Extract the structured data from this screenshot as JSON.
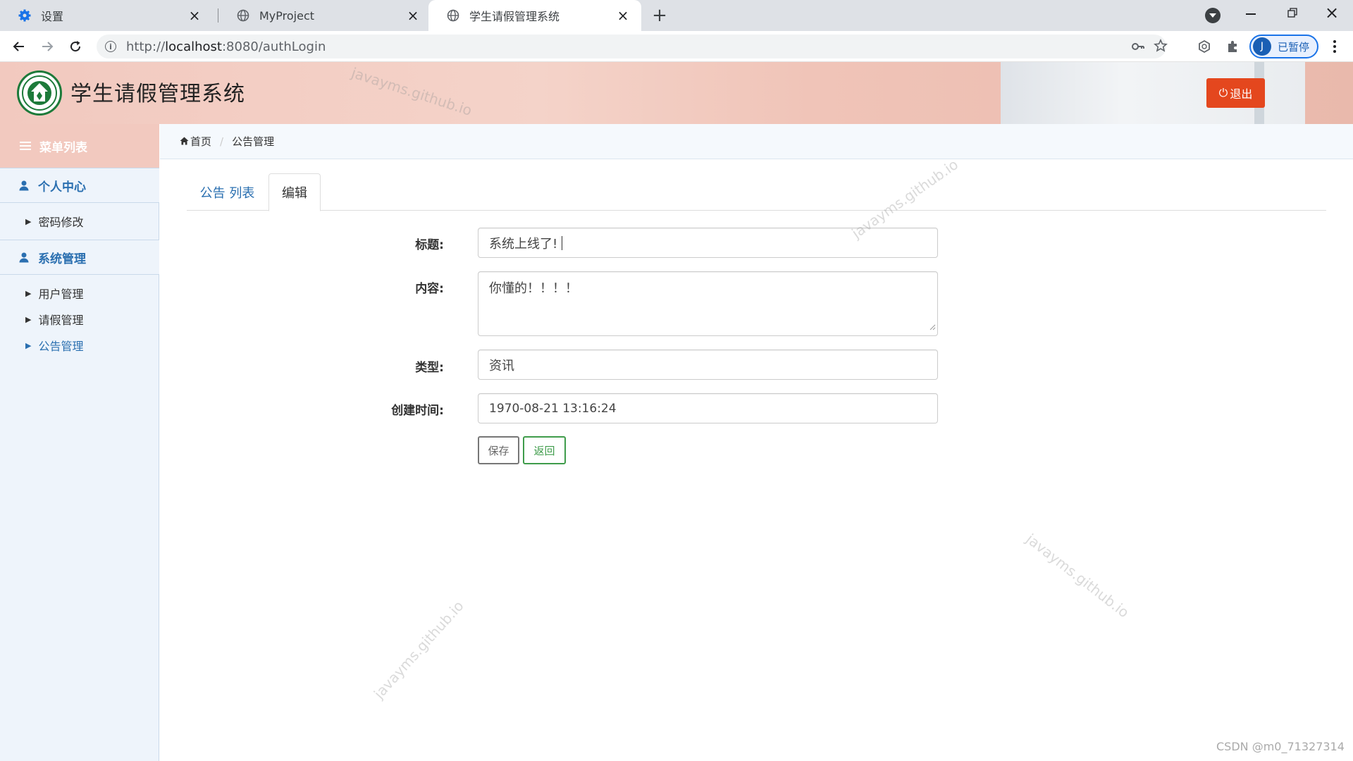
{
  "browser": {
    "tabs": [
      {
        "label": "设置",
        "icon": "gear-icon"
      },
      {
        "label": "MyProject",
        "icon": "globe-icon"
      },
      {
        "label": "学生请假管理系统",
        "icon": "globe-icon"
      }
    ],
    "active_tab": 2,
    "url_prefix": "http://",
    "url_host": "localhost",
    "url_path": ":8080/authLogin",
    "profile_initial": "J",
    "profile_label": "已暂停"
  },
  "app": {
    "title": "学生请假管理系统",
    "logout_label": "退出",
    "watermark": "javayms.github.io"
  },
  "sidebar": {
    "header": "菜单列表",
    "groups": [
      {
        "label": "个人中心",
        "items": [
          "密码修改"
        ]
      },
      {
        "label": "系统管理",
        "items": [
          "用户管理",
          "请假管理",
          "公告管理"
        ]
      }
    ],
    "active_item": "公告管理"
  },
  "breadcrumb": {
    "home": "首页",
    "current": "公告管理"
  },
  "content_tabs": {
    "list": "公告 列表",
    "edit": "编辑"
  },
  "form": {
    "title_label": "标题:",
    "title_value": "系统上线了!",
    "content_label": "内容:",
    "content_value": "你懂的！！！！",
    "type_label": "类型:",
    "type_value": "资讯",
    "created_label": "创建时间:",
    "created_value": "1970-08-21 13:16:24",
    "save_label": "保存",
    "back_label": "返回"
  },
  "footer_credit": "CSDN @m0_71327314",
  "colors": {
    "accent": "#2a6fb0",
    "logout": "#e4471e",
    "back_button": "#3f9c4b"
  }
}
